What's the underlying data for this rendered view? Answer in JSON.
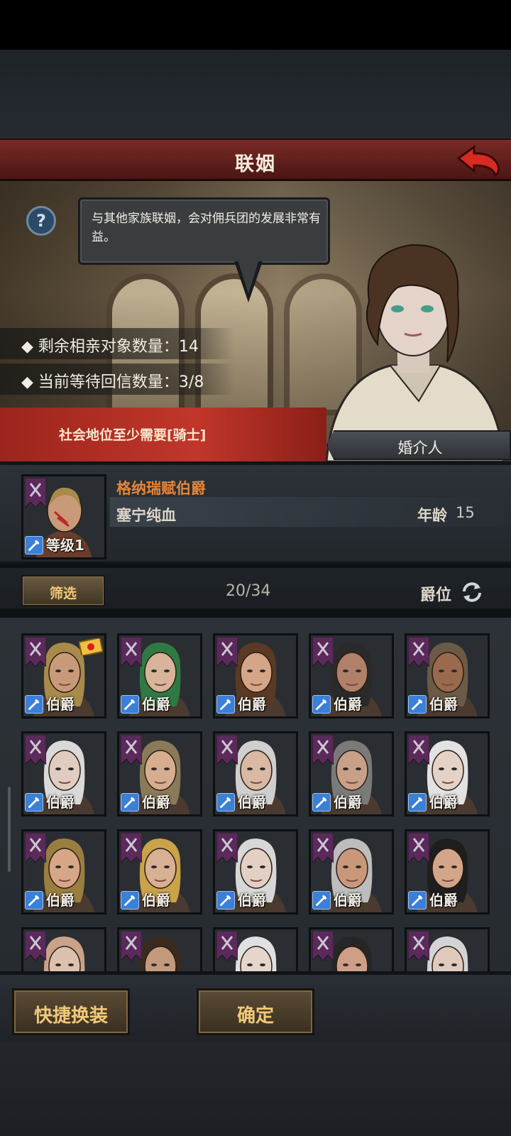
{
  "header": {
    "title": "联姻"
  },
  "help": {
    "icon": "question-icon",
    "symbol": "?"
  },
  "dialog": {
    "text": "与其他家族联姻，会对佣兵团的发展非常有益。"
  },
  "info": {
    "remaining": "◆ 剩余相亲对象数量：14",
    "waiting": "◆ 当前等待回信数量：3/8"
  },
  "requirement": "社会地位至少需要[骑士]",
  "npc": {
    "label": "婚介人"
  },
  "selected": {
    "name": "格纳瑞赋伯爵",
    "race": "塞宁纯血",
    "age_label": "年龄",
    "age": "15",
    "level": "等级1"
  },
  "filter": {
    "button": "筛选",
    "count": "20/34",
    "sort_label": "爵位"
  },
  "candidates": [
    {
      "title": "伯爵",
      "hair": "#a88a4a",
      "skin": "#c99a7a",
      "seal": true
    },
    {
      "title": "伯爵",
      "hair": "#2f7a44",
      "skin": "#d8b49a",
      "seal": false
    },
    {
      "title": "伯爵",
      "hair": "#5a3a24",
      "skin": "#d4a586",
      "seal": false
    },
    {
      "title": "伯爵",
      "hair": "#2a2a2a",
      "skin": "#b08068",
      "seal": false
    },
    {
      "title": "伯爵",
      "hair": "#6b5a46",
      "skin": "#9a6a4e",
      "seal": false
    },
    {
      "title": "伯爵",
      "hair": "#d9d9d9",
      "skin": "#e0cdc0",
      "seal": false
    },
    {
      "title": "伯爵",
      "hair": "#8a7a5a",
      "skin": "#d6ad8e",
      "seal": false
    },
    {
      "title": "伯爵",
      "hair": "#cfcfcf",
      "skin": "#d9b8a4",
      "seal": false
    },
    {
      "title": "伯爵",
      "hair": "#7a7a7a",
      "skin": "#c8a088",
      "seal": false
    },
    {
      "title": "伯爵",
      "hair": "#e2e2e2",
      "skin": "#e4d2c6",
      "seal": false
    },
    {
      "title": "伯爵",
      "hair": "#9a7e40",
      "skin": "#d5a787",
      "seal": false
    },
    {
      "title": "伯爵",
      "hair": "#c9a24a",
      "skin": "#d8b093",
      "seal": false
    },
    {
      "title": "伯爵",
      "hair": "#d7d7d7",
      "skin": "#e3d0c5",
      "seal": false
    },
    {
      "title": "伯爵",
      "hair": "#bdbdbd",
      "skin": "#c9977a",
      "seal": false
    },
    {
      "title": "伯爵",
      "hair": "#1e1e1e",
      "skin": "#d3a68a",
      "seal": false
    },
    {
      "title": "",
      "hair": "#c9a28a",
      "skin": "#dcc0ae",
      "seal": false
    },
    {
      "title": "",
      "hair": "#3a2a1e",
      "skin": "#c49a7c",
      "seal": false
    },
    {
      "title": "",
      "hair": "#e0e0e0",
      "skin": "#e6d5ca",
      "seal": false
    },
    {
      "title": "",
      "hair": "#262626",
      "skin": "#cf9e86",
      "seal": false
    },
    {
      "title": "",
      "hair": "#d4d4d4",
      "skin": "#dfcabd",
      "seal": false
    }
  ],
  "buttons": {
    "quick_outfit": "快捷换装",
    "confirm": "确定"
  },
  "colors": {
    "accent_red": "#9b251d",
    "gold_text": "#f1c97a",
    "name_orange": "#e5853a",
    "sword_blue": "#3b7fd6"
  }
}
